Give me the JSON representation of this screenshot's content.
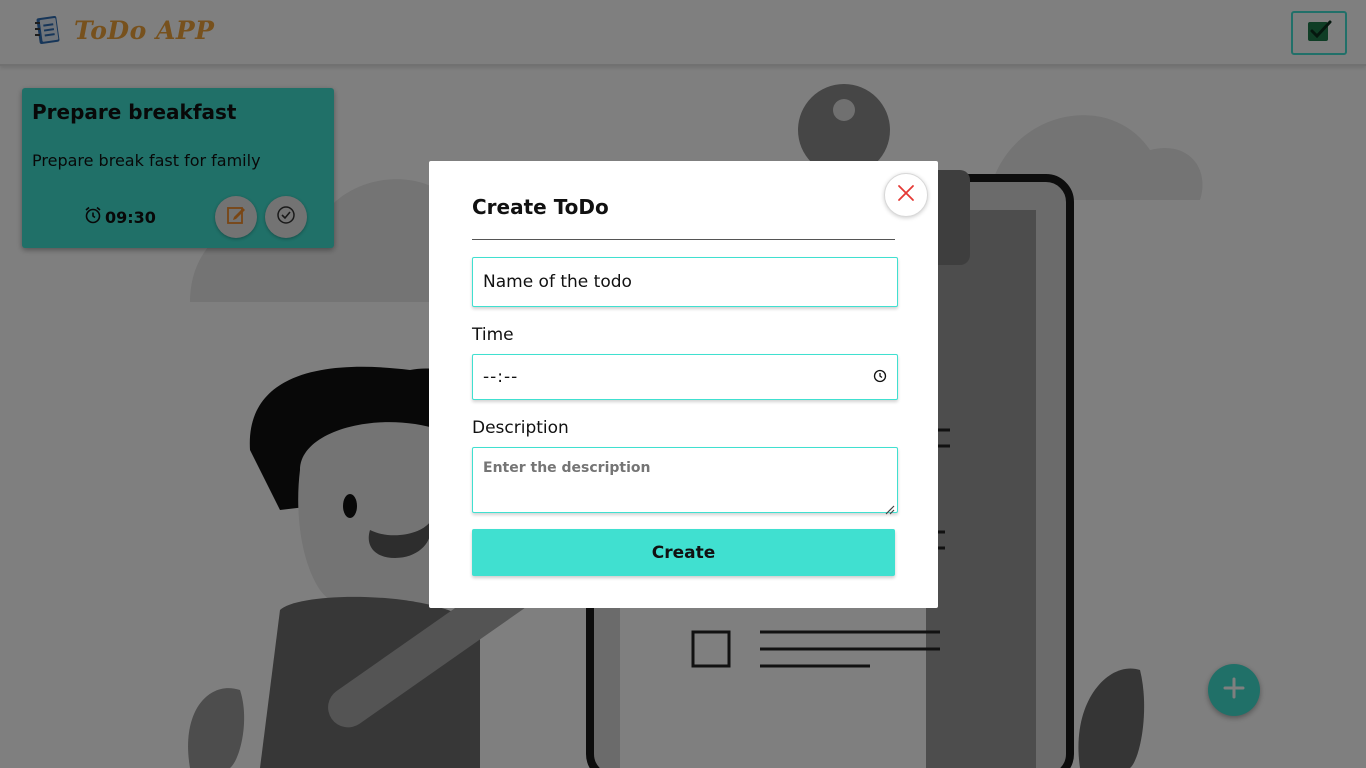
{
  "navbar": {
    "app_name": "ToDo APP",
    "logo_icon": "notebook-icon",
    "completed_icon": "checkbox-checked-icon"
  },
  "todos": [
    {
      "title": "Prepare breakfast",
      "description": "Prepare break fast for family",
      "time": "09:30",
      "time_icon": "alarm-clock-icon",
      "edit_icon": "edit-icon",
      "done_icon": "check-circle-icon"
    }
  ],
  "fab": {
    "icon": "plus-icon"
  },
  "modal": {
    "title": "Create ToDo",
    "close_icon": "close-icon",
    "name_field": {
      "value": "Name of the todo"
    },
    "time_field": {
      "label": "Time",
      "value": "--:--",
      "icon": "clock-icon"
    },
    "description_field": {
      "label": "Description",
      "placeholder": "Enter the description"
    },
    "create_button": "Create"
  },
  "colors": {
    "accent": "#40e0d0",
    "brand": "#eea33a",
    "close": "#e53935",
    "edit": "#f28c28"
  }
}
